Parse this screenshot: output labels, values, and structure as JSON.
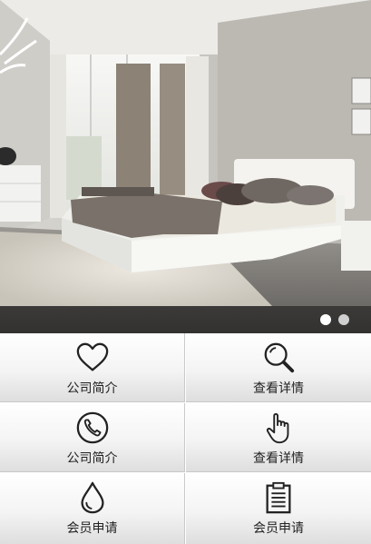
{
  "banner": {
    "image": "bedroom-interior-photo",
    "slides": 2,
    "active_slide": 1
  },
  "menu": {
    "items": [
      {
        "label": "公司简介",
        "icon": "heart-icon"
      },
      {
        "label": "查看详情",
        "icon": "search-icon"
      },
      {
        "label": "公司简介",
        "icon": "phone-icon"
      },
      {
        "label": "查看详情",
        "icon": "pointer-hand-icon"
      },
      {
        "label": "会员申请",
        "icon": "water-drop-icon"
      },
      {
        "label": "会员申请",
        "icon": "clipboard-icon"
      }
    ]
  },
  "colors": {
    "icon_stroke": "#222222",
    "dot_active": "#ffffff",
    "dot_inactive": "#d0d0d0"
  }
}
